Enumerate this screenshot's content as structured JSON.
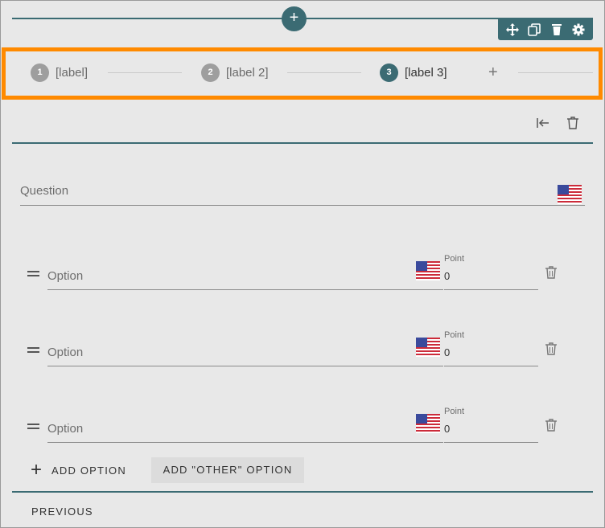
{
  "top_add": {
    "label": "+"
  },
  "toolbar": {
    "items": [
      {
        "icon": "move-icon"
      },
      {
        "icon": "copy-icon"
      },
      {
        "icon": "delete-icon"
      },
      {
        "icon": "gear-icon"
      }
    ]
  },
  "stepper": {
    "steps": [
      {
        "number": "1",
        "label": "[label]",
        "active": false
      },
      {
        "number": "2",
        "label": "[label 2]",
        "active": false
      },
      {
        "number": "3",
        "label": "[label 3]",
        "active": true
      }
    ],
    "add_label": "+"
  },
  "header_actions": [
    {
      "icon": "collapse-left-icon"
    },
    {
      "icon": "trash-icon"
    }
  ],
  "question": {
    "placeholder": "Question",
    "flag": "us-flag-icon"
  },
  "options": [
    {
      "placeholder": "Option",
      "point_label": "Point",
      "point_value": "0"
    },
    {
      "placeholder": "Option",
      "point_label": "Point",
      "point_value": "0"
    },
    {
      "placeholder": "Option",
      "point_label": "Point",
      "point_value": "0"
    }
  ],
  "buttons": {
    "add_option_icon": "+",
    "add_option": "ADD OPTION",
    "add_other": "ADD \"OTHER\" OPTION",
    "previous": "PREVIOUS"
  },
  "colors": {
    "accent": "#3b6b73",
    "highlight": "#ff8a00",
    "background": "#e8e8e8"
  }
}
